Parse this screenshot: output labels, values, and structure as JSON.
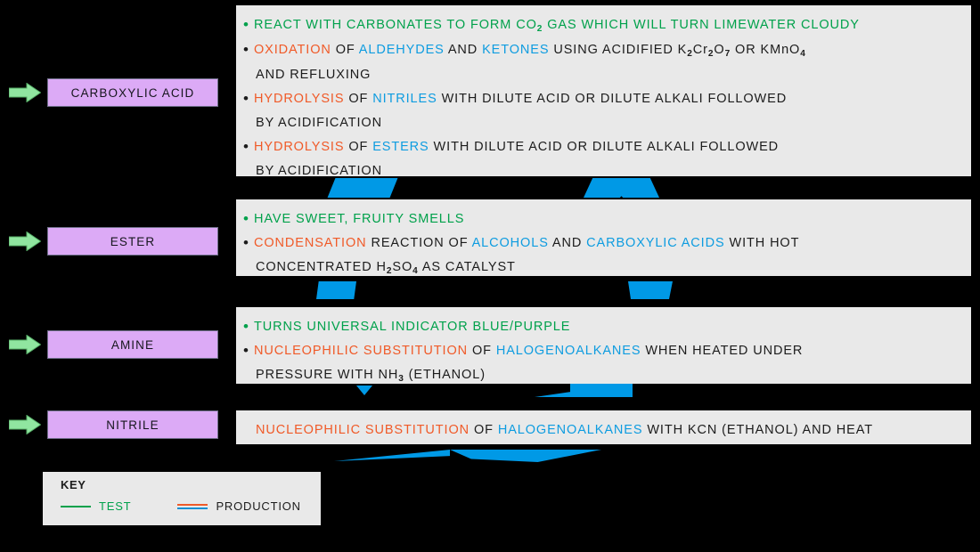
{
  "title": "Carboxylic acid, ester, amine and nitrile tests and production",
  "colors": {
    "background": "#000000",
    "panel": "#e9e9e9",
    "chip": "#dcaaf6",
    "test_green": "#00a14b",
    "production_orange": "#f05a28",
    "link_blue": "#0e9ce0",
    "arrow_green": "#90e5a0",
    "deco_blue": "#0099e6"
  },
  "rows": [
    {
      "arrow_icon": "right-arrow-icon",
      "chip_label": "CARBOXYLIC ACID",
      "lines": [
        {
          "bullet": "•",
          "bullet_color": "green",
          "indent": false,
          "segments": [
            {
              "text": "REACT WITH CARBONATES TO FORM CO",
              "color": "green"
            },
            {
              "text": "2",
              "color": "green",
              "sub": true
            },
            {
              "text": " GAS WHICH WILL TURN LIMEWATER CLOUDY",
              "color": "green"
            }
          ]
        },
        {
          "bullet": "•",
          "bullet_color": "dark",
          "indent": false,
          "segments": [
            {
              "text": "OXIDATION",
              "color": "orange"
            },
            {
              "text": " OF ",
              "color": "dark"
            },
            {
              "text": "ALDEHYDES",
              "color": "blue"
            },
            {
              "text": " AND ",
              "color": "dark"
            },
            {
              "text": "KETONES",
              "color": "blue"
            },
            {
              "text": " USING ACIDIFIED ",
              "color": "dark"
            },
            {
              "text": "K",
              "color": "dark"
            },
            {
              "text": "2",
              "color": "dark",
              "sub": true
            },
            {
              "text": "Cr",
              "color": "dark"
            },
            {
              "text": "2",
              "color": "dark",
              "sub": true
            },
            {
              "text": "O",
              "color": "dark"
            },
            {
              "text": "7",
              "color": "dark",
              "sub": true
            },
            {
              "text": " OR KMnO",
              "color": "dark"
            },
            {
              "text": "4",
              "color": "dark",
              "sub": true
            }
          ]
        },
        {
          "bullet": "",
          "bullet_color": "dark",
          "indent": true,
          "segments": [
            {
              "text": "AND REFLUXING",
              "color": "dark"
            }
          ]
        },
        {
          "bullet": "•",
          "bullet_color": "dark",
          "indent": false,
          "segments": [
            {
              "text": "HYDROLYSIS",
              "color": "orange"
            },
            {
              "text": " OF ",
              "color": "dark"
            },
            {
              "text": "NITRILES",
              "color": "blue"
            },
            {
              "text": " WITH DILUTE ACID OR DILUTE ALKALI FOLLOWED",
              "color": "dark"
            }
          ]
        },
        {
          "bullet": "",
          "bullet_color": "dark",
          "indent": true,
          "segments": [
            {
              "text": "BY ACIDIFICATION",
              "color": "dark"
            }
          ]
        },
        {
          "bullet": "•",
          "bullet_color": "dark",
          "indent": false,
          "segments": [
            {
              "text": "HYDROLYSIS",
              "color": "orange"
            },
            {
              "text": " OF ",
              "color": "dark"
            },
            {
              "text": "ESTERS",
              "color": "blue"
            },
            {
              "text": " WITH DILUTE ACID OR DILUTE ALKALI FOLLOWED",
              "color": "dark"
            }
          ]
        },
        {
          "bullet": "",
          "bullet_color": "dark",
          "indent": true,
          "segments": [
            {
              "text": "BY ACIDIFICATION",
              "color": "dark"
            }
          ]
        }
      ]
    },
    {
      "arrow_icon": "right-arrow-icon",
      "chip_label": "ESTER",
      "lines": [
        {
          "bullet": "•",
          "bullet_color": "green",
          "indent": false,
          "segments": [
            {
              "text": "HAVE SWEET, FRUITY SMELLS",
              "color": "green"
            }
          ]
        },
        {
          "bullet": "•",
          "bullet_color": "dark",
          "indent": false,
          "segments": [
            {
              "text": "CONDENSATION",
              "color": "orange"
            },
            {
              "text": " REACTION OF ",
              "color": "dark"
            },
            {
              "text": "ALCOHOLS",
              "color": "blue"
            },
            {
              "text": " AND ",
              "color": "dark"
            },
            {
              "text": "CARBOXYLIC ACIDS",
              "color": "blue"
            },
            {
              "text": " WITH HOT",
              "color": "dark"
            }
          ]
        },
        {
          "bullet": "",
          "bullet_color": "dark",
          "indent": true,
          "segments": [
            {
              "text": "CONCENTRATED H",
              "color": "dark"
            },
            {
              "text": "2",
              "color": "dark",
              "sub": true
            },
            {
              "text": "SO",
              "color": "dark"
            },
            {
              "text": "4",
              "color": "dark",
              "sub": true
            },
            {
              "text": " AS CATALYST",
              "color": "dark"
            }
          ]
        }
      ]
    },
    {
      "arrow_icon": "right-arrow-icon",
      "chip_label": "AMINE",
      "lines": [
        {
          "bullet": "•",
          "bullet_color": "green",
          "indent": false,
          "segments": [
            {
              "text": "TURNS UNIVERSAL INDICATOR BLUE/PURPLE",
              "color": "green"
            }
          ]
        },
        {
          "bullet": "•",
          "bullet_color": "dark",
          "indent": false,
          "segments": [
            {
              "text": "NUCLEOPHILIC SUBSTITUTION",
              "color": "orange"
            },
            {
              "text": " OF ",
              "color": "dark"
            },
            {
              "text": "HALOGENOALKANES",
              "color": "blue"
            },
            {
              "text": " WHEN HEATED UNDER",
              "color": "dark"
            }
          ]
        },
        {
          "bullet": "",
          "bullet_color": "dark",
          "indent": true,
          "segments": [
            {
              "text": "PRESSURE WITH NH",
              "color": "dark"
            },
            {
              "text": "3",
              "color": "dark",
              "sub": true
            },
            {
              "text": " (ETHANOL)",
              "color": "dark"
            }
          ]
        }
      ]
    },
    {
      "arrow_icon": "right-arrow-icon",
      "chip_label": "NITRILE",
      "lines": [
        {
          "bullet": "",
          "bullet_color": "dark",
          "indent": true,
          "segments": [
            {
              "text": "NUCLEOPHILIC SUBSTITUTION",
              "color": "orange"
            },
            {
              "text": " OF ",
              "color": "dark"
            },
            {
              "text": "HALOGENOALKANES",
              "color": "blue"
            },
            {
              "text": " WITH KCN (ETHANOL) AND HEAT",
              "color": "dark"
            }
          ]
        }
      ]
    }
  ],
  "key": {
    "title": "KEY",
    "items": [
      {
        "label": "TEST",
        "label_color": "green",
        "swatch": "single-green-line"
      },
      {
        "label": "PRODUCTION",
        "label_color": "dark",
        "swatch": "orange-over-blue-lines"
      }
    ]
  }
}
